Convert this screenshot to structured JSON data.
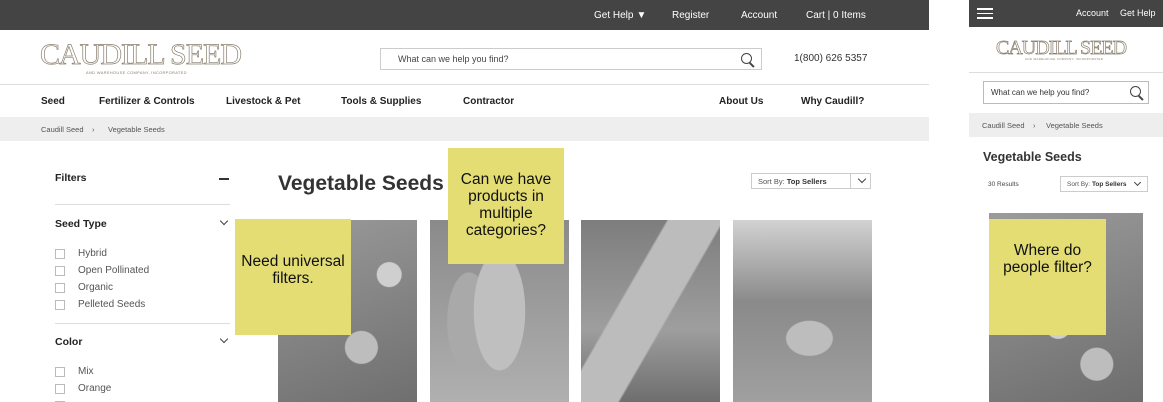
{
  "desktop": {
    "topbar": {
      "get_help": "Get Help",
      "register": "Register",
      "account": "Account",
      "cart": "Cart | 0 Items"
    },
    "logo": {
      "name": "CAUDILL SEED",
      "tagline": "AND WAREHOUSE COMPANY, INCORPORATED"
    },
    "search": {
      "placeholder": "What can we help you find?",
      "icon": "search-icon"
    },
    "phone": "1(800) 626 5357",
    "nav": {
      "seed": "Seed",
      "fertilizer": "Fertilizer & Controls",
      "livestock": "Livestock & Pet",
      "tools": "Tools & Supplies",
      "contractor": "Contractor",
      "about": "About Us",
      "why": "Why Caudill?"
    },
    "breadcrumb": {
      "home": "Caudill Seed",
      "sep": "›",
      "current": "Vegetable Seeds"
    },
    "filters": {
      "title": "Filters",
      "groups": [
        {
          "title": "Seed Type",
          "options": [
            "Hybrid",
            "Open Pollinated",
            "Organic",
            "Pelleted Seeds"
          ]
        },
        {
          "title": "Color",
          "options": [
            "Mix",
            "Orange"
          ]
        }
      ]
    },
    "page_title": "Vegetable Seeds",
    "sort": {
      "prefix": "Sort By:",
      "value": "Top Sellers"
    },
    "notes": {
      "universal": "Need universal filters.",
      "categories": "Can we have products  in multiple categories?"
    }
  },
  "mobile": {
    "topbar": {
      "account": "Account",
      "get_help": "Get Help"
    },
    "logo": {
      "name": "CAUDILL SEED",
      "tagline": "AND WAREHOUSE COMPANY, INCORPORATED"
    },
    "search": {
      "placeholder": "What can we help you find?"
    },
    "breadcrumb": {
      "home": "Caudill Seed",
      "sep": "›",
      "current": "Vegetable Seeds"
    },
    "page_title": "Vegetable Seeds",
    "results": "30 Results",
    "sort": {
      "prefix": "Sort By:",
      "value": "Top Sellers"
    },
    "note": "Where do people filter?"
  },
  "colors": {
    "topbar": "#444444",
    "sticky_note": "#e3dd74",
    "breadcrumb_bg": "#eeeeee",
    "logo_outline": "#8a7f6f"
  }
}
